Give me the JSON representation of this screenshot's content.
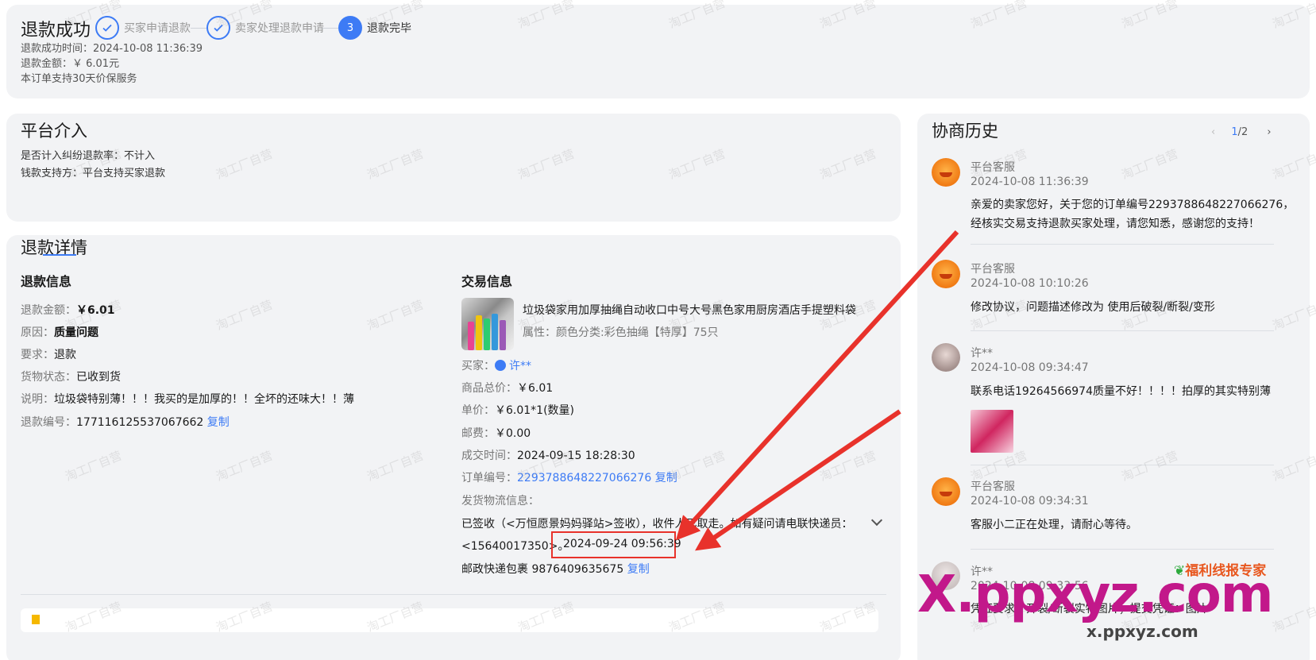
{
  "status": {
    "title": "退款成功",
    "steps": [
      {
        "label": "买家申请退款"
      },
      {
        "label": "卖家处理退款申请"
      },
      {
        "label": "退款完毕",
        "num": "3"
      }
    ],
    "success_time": "退款成功时间：2024-10-08 11:36:39",
    "amount": "退款金额：￥ 6.01元",
    "guarantee": "本订单支持30天价保服务"
  },
  "platform": {
    "title": "平台介入",
    "dispute_rate": "是否计入纠纷退款率：不计入",
    "payer": "钱款支持方：平台支持买家退款"
  },
  "detail": {
    "title": "退款详情",
    "refund_info": {
      "heading": "退款信息",
      "amount_k": "退款金额：",
      "amount_v": "￥6.01",
      "reason_k": "原因：",
      "reason_v": "质量问题",
      "request_k": "要求：",
      "request_v": "退款",
      "goods_k": "货物状态：",
      "goods_v": "已收到货",
      "desc_k": "说明：",
      "desc_v": "垃圾袋特别薄！！！我买的是加厚的！！全坏的还味大！！薄",
      "no_k": "退款编号：",
      "no_v": "177116125537067662",
      "copy": "复制"
    },
    "trade_info": {
      "heading": "交易信息",
      "product_name": "垃圾袋家用加厚抽绳自动收口中号大号黑色家用厨房酒店手提塑料袋",
      "attr": "属性：颜色分类:彩色抽绳【特厚】75只",
      "buyer_k": "买家：",
      "buyer_v": "许**",
      "total_k": "商品总价：",
      "total_v": "￥6.01",
      "unit_k": "单价：",
      "unit_v": "￥6.01*1(数量)",
      "ship_k": "邮费：",
      "ship_v": "￥0.00",
      "deal_k": "成交时间：",
      "deal_v": "2024-09-15 18:28:30",
      "order_k": "订单编号：",
      "order_v": "2293788648227066276",
      "copy": "复制",
      "logistics_k": "发货物流信息：",
      "logistics_line1": "已签收（<万恒愿景妈妈驿站>签收），收件人已取走。如有疑问请电联快递员：",
      "logistics_line2": "<15640017350>。",
      "logistics_time": "2024-09-24 09:56:39",
      "express": "邮政快递包裹 9876409635675",
      "express_copy": "复制"
    }
  },
  "history": {
    "title": "协商历史",
    "page_current": "1",
    "page_total": "/2",
    "entries": [
      {
        "name": "平台客服",
        "time": "2024-10-08 11:36:39",
        "msg1": "亲爱的卖家您好，关于您的订单编号2293788648227066276，",
        "msg2": "经核实交易支持退款买家处理，请您知悉，感谢您的支持！"
      },
      {
        "name": "平台客服",
        "time": "2024-10-08 10:10:26",
        "msg1": "修改协议，问题描述修改为 使用后破裂/断裂/变形"
      },
      {
        "name": "许**",
        "time": "2024-10-08 09:34:47",
        "msg1": "联系电话19264566974质量不好！！！！拍厚的其实特别薄"
      },
      {
        "name": "平台客服",
        "time": "2024-10-08 09:34:31",
        "msg1": "客服小二正在处理，请耐心等待。"
      },
      {
        "name": "许**",
        "time": "2024-10-08 09:33:56",
        "msg1": "凭证要求：开裂/断裂实物图片；提交凭证：图片"
      }
    ]
  },
  "overlay": {
    "watermark": "淘工厂自营",
    "brand_main": "X.ppxyz.com",
    "brand_sub": "x.ppxyz.com",
    "brand_badge": "福利线报专家",
    "colors": {
      "accent": "#3d7bf5",
      "arrow": "#e8322b"
    }
  }
}
